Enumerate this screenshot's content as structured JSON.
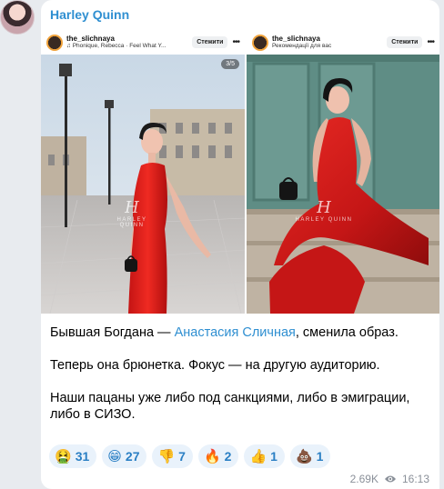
{
  "channel": {
    "name": "Harley Quinn"
  },
  "media": {
    "left_post": {
      "username": "the_slichnaya",
      "subtitle": "Phonique, Rebecca · Feel What Y...",
      "follow_label": "Стежити",
      "counter": "3/5",
      "watermark": "HARLEY QUINN"
    },
    "right_post": {
      "username": "the_slichnaya",
      "subtitle": "Рекомендації для вас",
      "follow_label": "Стежити",
      "watermark": "HARLEY QUINN"
    }
  },
  "caption": {
    "line1_before": "Бывшая Богдана — ",
    "line1_link": "Анастасия Сличная",
    "line1_after": ", сменила образ.",
    "para2": "Теперь она брюнетка. Фокус — на другую аудиторию.",
    "para3": "Наши пацаны уже либо под санкциями, либо в эмиграции, либо в СИЗО."
  },
  "reactions": [
    {
      "emoji": "🤮",
      "count": "31"
    },
    {
      "emoji": "😁",
      "count": "27"
    },
    {
      "emoji": "👎",
      "count": "7"
    },
    {
      "emoji": "🔥",
      "count": "2"
    },
    {
      "emoji": "👍",
      "count": "1"
    },
    {
      "emoji": "💩",
      "count": "1"
    }
  ],
  "footer": {
    "views": "2.69K",
    "time": "16:13",
    "views_icon": "eye-icon"
  }
}
